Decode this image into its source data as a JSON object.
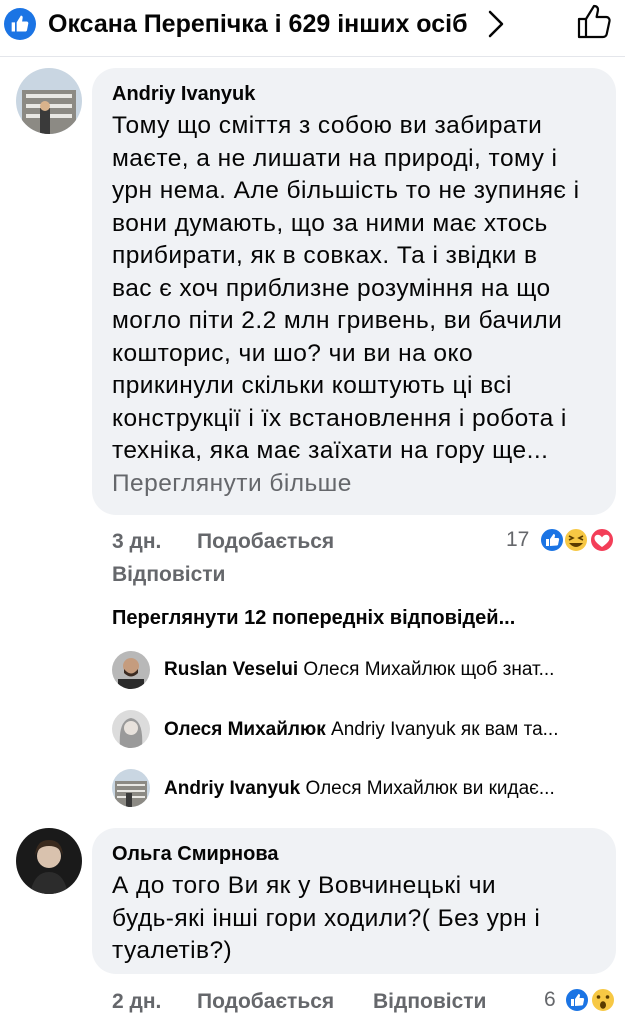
{
  "header": {
    "reactions_text": "Оксана Перепічка і 629 інших осіб"
  },
  "comment1": {
    "author": "Andriy Ivanyuk",
    "lines": [
      "Тому що сміття з собою ви забирати",
      "маєте, а не лишати на природі, тому і",
      "урн нема. Але більшість то не зупиняє і",
      "вони думають, що за ними має хтось",
      "прибирати, як в совках. Та і звідки в",
      "вас є хоч приблизне розуміння на що",
      "могло піти 2.2 млн гривень, ви бачили",
      "кошторис, чи шо? чи ви на око",
      "прикинули скільки коштують ці всі",
      "конструкції і їх встановлення і робота і",
      "техніка, яка має заїхати на гору ще..."
    ],
    "see_more": "Переглянути більше",
    "time": "3 дн.",
    "like": "Подобається",
    "reply": "Відповісти",
    "reaction_count": "17"
  },
  "previous_replies": "Переглянути 12 попередніх відповідей...",
  "replies": [
    {
      "name": "Ruslan Veselui",
      "text": "Олеся Михайлюк щоб знат..."
    },
    {
      "name": "Олеся Михайлюк",
      "text": "Andriy Ivanyuk як вам та..."
    },
    {
      "name": "Andriy Ivanyuk",
      "text": "Олеся Михайлюк ви кидає..."
    }
  ],
  "comment2": {
    "author": "Ольга Смирнова",
    "lines": [
      "А до того Ви як у Вовчинецькі чи",
      "будь-які інші гори ходили?( Без урн і",
      "туалетів?)"
    ],
    "time": "2 дн.",
    "like": "Подобається",
    "reply": "Відповісти",
    "reaction_count": "6"
  },
  "colors": {
    "like_blue": "#1b74e4",
    "bubble_bg": "#f0f2f5",
    "meta_gray": "#65676b",
    "haha_yellow": "#f7c844",
    "love_red": "#f33e58"
  }
}
